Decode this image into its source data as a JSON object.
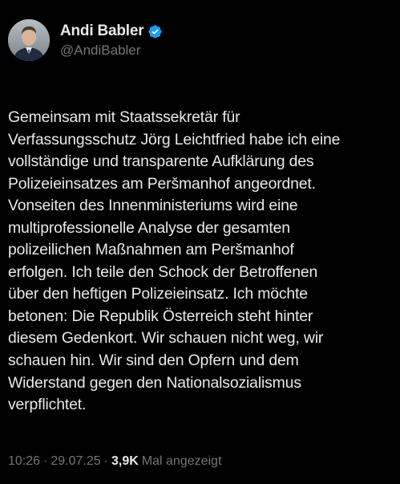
{
  "author": {
    "display_name": "Andi Babler",
    "handle": "@AndiBabler",
    "verified": true,
    "verified_color": "#1d9bf0",
    "avatar_icon": "profile-photo"
  },
  "post": {
    "lines": [
      "Gemeinsam mit Staatssekretär für",
      "Verfassungsschutz Jörg Leichtfried habe ich eine",
      "vollständige und transparente Aufklärung des",
      "Polizeieinsatzes am Peršmanhof angeordnet.",
      "Vonseiten des Innenministeriums wird eine",
      "multiprofessionelle Analyse der gesamten",
      "polizeilichen Maßnahmen am Peršmanhof",
      "erfolgen. Ich teile den Schock der Betroffenen",
      "über den heftigen Polizeieinsatz. Ich möchte",
      "betonen: Die Republik Österreich steht hinter",
      "diesem Gedenkort. Wir schauen nicht weg, wir",
      "schauen hin. Wir sind den Opfern und dem",
      "Widerstand gegen den Nationalsozialismus",
      "verpflichtet."
    ]
  },
  "meta": {
    "time": "10:26",
    "date": "29.07.25",
    "separator": "·",
    "views_count": "3,9K",
    "views_label": "Mal angezeigt"
  },
  "colors": {
    "background": "#000000",
    "text_primary": "#e7e9ea",
    "text_secondary": "#71767b"
  }
}
